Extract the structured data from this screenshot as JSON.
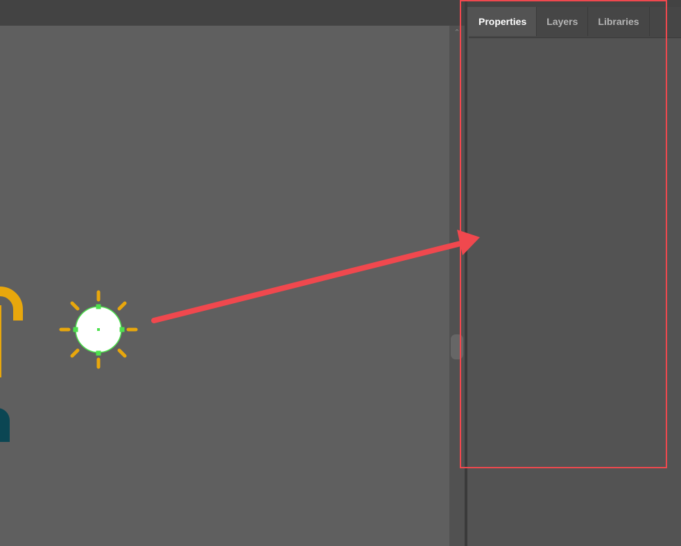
{
  "panel": {
    "tabs": [
      {
        "label": "Properties",
        "active": true
      },
      {
        "label": "Layers",
        "active": false
      },
      {
        "label": "Libraries",
        "active": false
      }
    ]
  },
  "scrollbar": {
    "up_icon": "chevron-up-icon"
  },
  "colors": {
    "canvas": "#5f5f5f",
    "panel": "#535353",
    "sun_rays": "#e8a70c",
    "selection": "#4ee04e",
    "annotation": "#f0484e",
    "teal_shape": "#0b4653"
  }
}
